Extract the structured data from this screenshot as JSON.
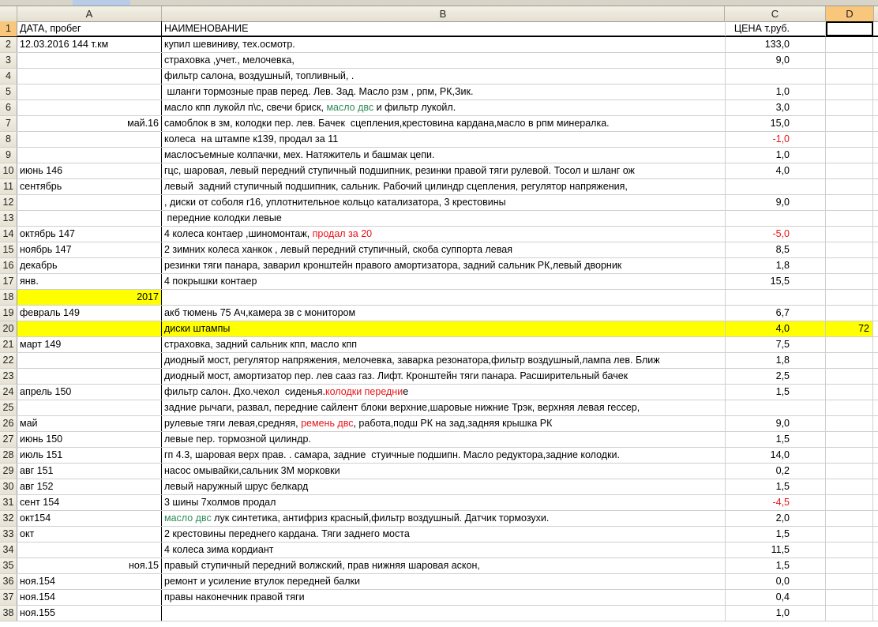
{
  "columns": [
    "A",
    "B",
    "C",
    "D"
  ],
  "active_column": "D",
  "colors": {
    "green": "#2e8b57",
    "red": "#e8141b",
    "highlight": "#ffff00"
  },
  "rows": [
    {
      "n": "1",
      "a": "ДАТА, пробег",
      "b": [
        {
          "t": "НАИМЕНОВАНИЕ"
        }
      ],
      "c": "ЦЕНА т.руб.",
      "d": ""
    },
    {
      "n": "2",
      "a": "12.03.2016 144 т.км",
      "b": [
        {
          "t": "купил шевиниву, тех.осмотр."
        }
      ],
      "c": "133,0"
    },
    {
      "n": "3",
      "a": "",
      "b": [
        {
          "t": "страховка ,учет., мелочевка,"
        }
      ],
      "c": "9,0"
    },
    {
      "n": "4",
      "a": "",
      "b": [
        {
          "t": "фильтр салона, воздушный, топливный, ."
        }
      ],
      "c": ""
    },
    {
      "n": "5",
      "a": "",
      "b": [
        {
          "t": " шланги тормозные прав перед. Лев. Зад. Масло рзм , рпм, РК,Зик."
        }
      ],
      "c": "1,0"
    },
    {
      "n": "6",
      "a": "",
      "b": [
        {
          "t": "масло кпп лукойл п\\с, свечи бриск, "
        },
        {
          "t": "масло двс",
          "col": "green"
        },
        {
          "t": " и фильтр лукойл."
        }
      ],
      "c": "3,0"
    },
    {
      "n": "7",
      "a": "май.16",
      "ar": true,
      "b": [
        {
          "t": "самоблок в зм, колодки пер. лев. Бачек  сцепления,крестовина кардана,масло в рпм минералка."
        }
      ],
      "c": "15,0"
    },
    {
      "n": "8",
      "a": "",
      "b": [
        {
          "t": "колеса  на штампе к139, продал за 11"
        }
      ],
      "c": "-1,0",
      "cr": true
    },
    {
      "n": "9",
      "a": "",
      "b": [
        {
          "t": "маслосъемные колпачки, мех. Натяжитель и башмак цепи."
        }
      ],
      "c": "1,0"
    },
    {
      "n": "10",
      "a": "июнь 146",
      "b": [
        {
          "t": "гцс, шаровая, левый передний ступичный подшипник, резинки правой тяги рулевой. Тосол и шланг ож"
        }
      ],
      "c": "4,0"
    },
    {
      "n": "11",
      "a": "сентябрь",
      "b": [
        {
          "t": "левый  задний ступичный подшипник, сальник. Рабочий цилиндр сцепления, регулятор напряжения,"
        }
      ],
      "c": ""
    },
    {
      "n": "12",
      "a": "",
      "b": [
        {
          "t": ", диски от соболя r16, уплотнительное кольцо катализатора, 3 крестовины"
        }
      ],
      "c": "9,0"
    },
    {
      "n": "13",
      "a": "",
      "b": [
        {
          "t": " передние колодки левые"
        }
      ],
      "c": ""
    },
    {
      "n": "14",
      "a": "октябрь 147",
      "b": [
        {
          "t": "4 колеса контаер ,шиномонтаж, "
        },
        {
          "t": "продал за 20",
          "col": "red"
        }
      ],
      "c": "-5,0",
      "cr": true
    },
    {
      "n": "15",
      "a": "ноябрь 147",
      "b": [
        {
          "t": "2 зимних колеса ханкок , левый передний ступичный, скоба суппорта левая"
        }
      ],
      "c": "8,5"
    },
    {
      "n": "16",
      "a": "декабрь",
      "b": [
        {
          "t": "резинки тяги панара, заварил кронштейн правого амортизатора, задний сальник РК,левый дворник"
        }
      ],
      "c": "1,8"
    },
    {
      "n": "17",
      "a": "янв.",
      "b": [
        {
          "t": "4 покрышки контаер"
        }
      ],
      "c": "15,5"
    },
    {
      "n": "18",
      "a": "2017",
      "ar": true,
      "ahl": true,
      "b": [
        {
          "t": ""
        }
      ],
      "c": ""
    },
    {
      "n": "19",
      "a": "февраль   149",
      "b": [
        {
          "t": "акб тюмень 75 Ач,камера зв с монитором"
        }
      ],
      "c": "6,7"
    },
    {
      "n": "20",
      "a": "",
      "hl": true,
      "b": [
        {
          "t": "диски штампы"
        }
      ],
      "c": "4,0",
      "d": "72"
    },
    {
      "n": "21",
      "a": "март 149",
      "b": [
        {
          "t": "страховка, задний сальник кпп, масло кпп"
        }
      ],
      "c": "7,5"
    },
    {
      "n": "22",
      "a": "",
      "b": [
        {
          "t": "диодный мост, регулятор напряжения, мелочевка, заварка резонатора,фильтр воздушный,лампа лев. Ближ"
        }
      ],
      "c": "1,8"
    },
    {
      "n": "23",
      "a": "",
      "b": [
        {
          "t": "диодный мост, амортизатор пер. лев сааз газ. Лифт. Кронштейн тяги панара. Расширительный бачек"
        }
      ],
      "c": "2,5"
    },
    {
      "n": "24",
      "a": "апрель 150",
      "b": [
        {
          "t": "фильтр салон. Дхо.чехол  сиденья."
        },
        {
          "t": "колодки передни",
          "col": "red"
        },
        {
          "t": "е"
        }
      ],
      "c": "1,5"
    },
    {
      "n": "25",
      "a": "",
      "b": [
        {
          "t": "задние рычаги, развал, передние сайлент блоки верхние,шаровые нижние Трэк, верхняя левая гессер,"
        }
      ],
      "c": ""
    },
    {
      "n": "26",
      "a": "май",
      "b": [
        {
          "t": "рулевые тяги левая,средняя, "
        },
        {
          "t": "ремень двс",
          "col": "red"
        },
        {
          "t": ", работа,подш РК на зад,задняя крышка РК"
        }
      ],
      "c": "9,0"
    },
    {
      "n": "27",
      "a": " июнь 150",
      "b": [
        {
          "t": "левые пер. тормозной цилиндр."
        }
      ],
      "c": "1,5"
    },
    {
      "n": "28",
      "a": "июль 151",
      "b": [
        {
          "t": "гп 4.3, шаровая верх прав. . самара, задние  стуичные подшипн. Масло редуктора,задние колодки."
        }
      ],
      "c": "14,0"
    },
    {
      "n": "29",
      "a": "авг 151",
      "b": [
        {
          "t": "насос омывайки,сальник 3М морковки"
        }
      ],
      "c": "0,2"
    },
    {
      "n": "30",
      "a": "авг 152",
      "b": [
        {
          "t": "левый наружный шрус белкард"
        }
      ],
      "c": "1,5"
    },
    {
      "n": "31",
      "a": "сент 154",
      "b": [
        {
          "t": "3 шины 7холмов продал"
        }
      ],
      "c": "-4,5",
      "cr": true
    },
    {
      "n": "32",
      "a": "окт154",
      "b": [
        {
          "t": "масло двс",
          "col": "green"
        },
        {
          "t": " лук синтетика, антифриз красный,фильтр воздушный. Датчик тормозухи."
        }
      ],
      "c": "2,0"
    },
    {
      "n": "33",
      "a": "окт",
      "b": [
        {
          "t": "2 крестовины переднего кардана. Тяги заднего моста"
        }
      ],
      "c": "1,5"
    },
    {
      "n": "34",
      "a": "",
      "b": [
        {
          "t": "4 колеса зима кордиант"
        }
      ],
      "c": "11,5"
    },
    {
      "n": "35",
      "a": "ноя.15",
      "ar": true,
      "b": [
        {
          "t": "правый ступичный передний волжский, прав нижняя шаровая аскон,"
        }
      ],
      "c": "1,5"
    },
    {
      "n": "36",
      "a": "ноя.154",
      "b": [
        {
          "t": "ремонт и усиление втулок передней балки"
        }
      ],
      "c": "0,0"
    },
    {
      "n": "37",
      "a": "ноя.154",
      "b": [
        {
          "t": "правы наконечник правой тяги"
        }
      ],
      "c": "0,4"
    },
    {
      "n": "38",
      "a": "ноя.155",
      "b": [
        {
          "t": ""
        }
      ],
      "c": "1,0"
    }
  ]
}
